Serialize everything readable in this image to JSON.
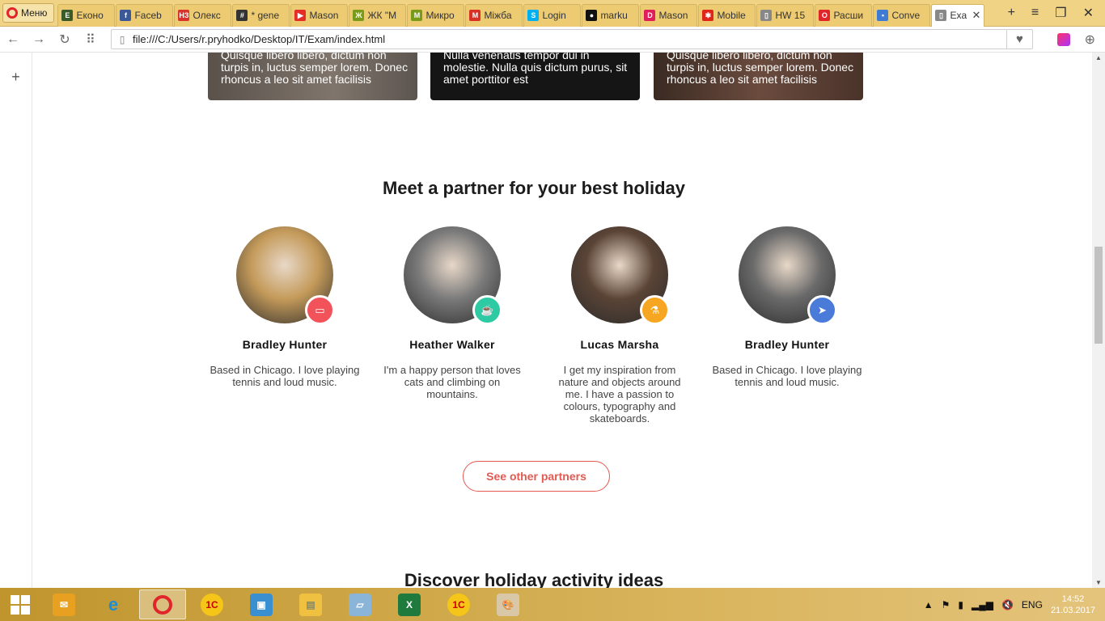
{
  "browser": {
    "menu_label": "Меню",
    "tabs": [
      {
        "label": "Еконо",
        "icon": "E",
        "color": "#3a5a2a"
      },
      {
        "label": "Faceb",
        "icon": "f",
        "color": "#3b5998"
      },
      {
        "label": "Олекс",
        "icon": "НЗ",
        "color": "#d9342b"
      },
      {
        "label": "* gene",
        "icon": "#",
        "color": "#333333"
      },
      {
        "label": "Mason",
        "icon": "▶",
        "color": "#e52d27"
      },
      {
        "label": "ЖК \"М",
        "icon": "Ж",
        "color": "#7a9a1a"
      },
      {
        "label": "Микро",
        "icon": "M",
        "color": "#7a9a1a"
      },
      {
        "label": "Міжба",
        "icon": "M",
        "color": "#d93025"
      },
      {
        "label": "Login",
        "icon": "S",
        "color": "#00aff0"
      },
      {
        "label": "marku",
        "icon": "●",
        "color": "#111111"
      },
      {
        "label": "Mason",
        "icon": "D",
        "color": "#e01e5a"
      },
      {
        "label": "Mobile",
        "icon": "✱",
        "color": "#e0251b"
      },
      {
        "label": "HW 15",
        "icon": "▯",
        "color": "#888888"
      },
      {
        "label": "Расши",
        "icon": "O",
        "color": "#e0252b"
      },
      {
        "label": "Conve",
        "icon": "▪",
        "color": "#3d7bd5"
      },
      {
        "label": "Exa",
        "icon": "▯",
        "color": "#888888"
      }
    ],
    "address": "file:///C:/Users/r.pryhodko/Desktop/IT/Exam/index.html"
  },
  "page": {
    "cards": [
      {
        "text": "Quisque libero libero, dictum non turpis in, luctus semper lorem. Donec rhoncus a leo sit amet facilisis"
      },
      {
        "text": "Nulla venenatis tempor dui in molestie. Nulla quis dictum purus, sit amet porttitor est"
      },
      {
        "text": "Quisque libero libero, dictum non turpis in, luctus semper lorem. Donec rhoncus a leo sit amet facilisis"
      }
    ],
    "partners_title": "Meet a partner for your best holiday",
    "partners": [
      {
        "name": "Bradley Hunter",
        "desc": "Based in Chicago. I love playing tennis and loud music.",
        "badge_icon": "tv-icon",
        "badge_color": "#f2525a",
        "avatar_color": "#c49a5a"
      },
      {
        "name": "Heather Walker",
        "desc": "I'm a happy person that loves cats and climbing on mountains.",
        "badge_icon": "coffee-icon",
        "badge_color": "#2ecaa3",
        "avatar_color": "#7a7a7a"
      },
      {
        "name": "Lucas Marsha",
        "desc": "I get my inspiration from nature and objects around me. I have a passion to colours, typography and skateboards.",
        "badge_icon": "flask-icon",
        "badge_color": "#f7a621",
        "avatar_color": "#5a4436"
      },
      {
        "name": "Bradley Hunter",
        "desc": "Based in Chicago. I love playing tennis and loud music.",
        "badge_icon": "paper-plane-icon",
        "badge_color": "#4a7bd8",
        "avatar_color": "#6a6a6a"
      }
    ],
    "see_partners_label": "See other partners",
    "activities_title": "Discover holiday activity ideas"
  },
  "taskbar": {
    "language": "ENG",
    "time": "14:52",
    "date": "21.03.2017"
  }
}
